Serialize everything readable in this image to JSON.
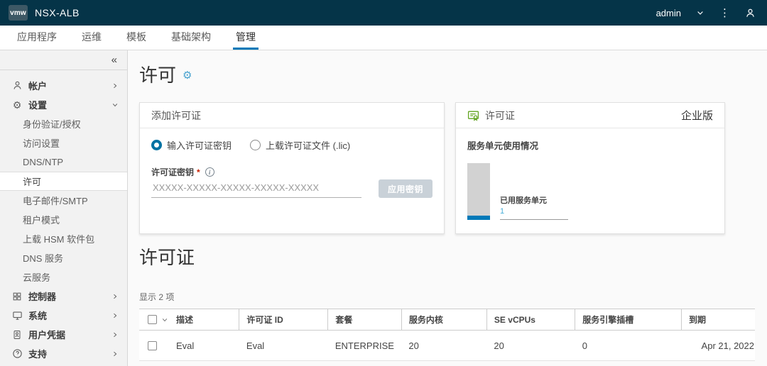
{
  "topbar": {
    "logo": "vmw",
    "product": "NSX-ALB",
    "username": "admin"
  },
  "tabs": [
    {
      "label": "应用程序"
    },
    {
      "label": "运维"
    },
    {
      "label": "模板"
    },
    {
      "label": "基础架构"
    },
    {
      "label": "管理",
      "active": true
    }
  ],
  "sidebar": {
    "items": [
      {
        "label": "帐户",
        "icon": "user-icon",
        "expandable": true
      },
      {
        "label": "设置",
        "icon": "gear-icon",
        "expanded": true
      },
      {
        "label": "身份验证/授权",
        "sub": true
      },
      {
        "label": "访问设置",
        "sub": true
      },
      {
        "label": "DNS/NTP",
        "sub": true
      },
      {
        "label": "许可",
        "sub": true,
        "active": true
      },
      {
        "label": "电子邮件/SMTP",
        "sub": true
      },
      {
        "label": "租户模式",
        "sub": true
      },
      {
        "label": "上载 HSM 软件包",
        "sub": true
      },
      {
        "label": "DNS 服务",
        "sub": true
      },
      {
        "label": "云服务",
        "sub": true
      },
      {
        "label": "控制器",
        "icon": "controller-icon",
        "expandable": true
      },
      {
        "label": "系统",
        "icon": "system-icon",
        "expandable": true
      },
      {
        "label": "用户凭据",
        "icon": "credentials-icon",
        "expandable": true
      },
      {
        "label": "支持",
        "icon": "support-icon",
        "expandable": true
      }
    ]
  },
  "page": {
    "title": "许可"
  },
  "add_license_card": {
    "title": "添加许可证",
    "radio_key_label": "输入许可证密钥",
    "radio_file_label": "上载许可证文件 (.lic)",
    "key_label": "许可证密钥",
    "required_marker": "*",
    "key_placeholder": "XXXXX-XXXXX-XXXXX-XXXXX-XXXXX",
    "key_value": "",
    "apply_button_label": "应用密钥"
  },
  "license_card": {
    "title": "许可证",
    "tier": "企业版",
    "usage_title": "服务单元使用情况",
    "used_label": "已用服务单元",
    "used_value": "1"
  },
  "chart_data": {
    "type": "bar",
    "categories": [
      "已用服务单元"
    ],
    "values": [
      1
    ],
    "title": "服务单元使用情况"
  },
  "licenses_section": {
    "title": "许可证",
    "count_text": "显示 2 项"
  },
  "table": {
    "headers": [
      "描述",
      "许可证 ID",
      "套餐",
      "服务内核",
      "SE vCPUs",
      "服务引擎插槽",
      "到期"
    ],
    "rows": [
      [
        "Eval",
        "Eval",
        "ENTERPRISE",
        "20",
        "20",
        "0",
        "Apr 21, 2022"
      ]
    ]
  },
  "icons": {
    "collapse": "«",
    "kebab": "⋮",
    "gear": "⚙",
    "info": "i",
    "question": "?"
  },
  "colors": {
    "topbar_bg": "#053448",
    "accent_blue": "#0079b8",
    "light_blue": "#49afd9",
    "green": "#62a420",
    "required_red": "#c92100"
  }
}
